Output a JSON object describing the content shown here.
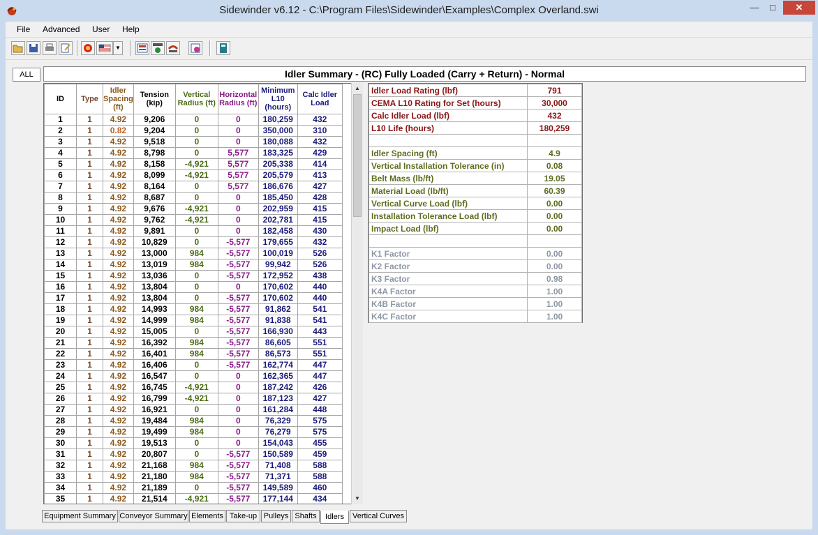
{
  "window": {
    "title": "Sidewinder v6.12 - C:\\Program Files\\Sidewinder\\Examples\\Complex Overland.swi"
  },
  "menu": [
    "File",
    "Advanced",
    "User",
    "Help"
  ],
  "filter_button": "ALL",
  "view_title": "Idler Summary - (RC) Fully Loaded (Carry + Return) - Normal",
  "table": {
    "headers": {
      "id": "ID",
      "type": "Type",
      "spacing": "Idler Spacing (ft)",
      "tension": "Tension (kip)",
      "vert": "Vertical Radius (ft)",
      "horiz": "Horizontal Radius (ft)",
      "l10": "Minimum L10 (hours)",
      "load": "Calc Idler Load"
    },
    "rows": [
      [
        "1",
        "1",
        "4.92",
        "9,206",
        "0",
        "0",
        "180,259",
        "432"
      ],
      [
        "2",
        "1",
        "0.82",
        "9,204",
        "0",
        "0",
        "350,000",
        "310"
      ],
      [
        "3",
        "1",
        "4.92",
        "9,518",
        "0",
        "0",
        "180,088",
        "432"
      ],
      [
        "4",
        "1",
        "4.92",
        "8,798",
        "0",
        "5,577",
        "183,325",
        "429"
      ],
      [
        "5",
        "1",
        "4.92",
        "8,158",
        "-4,921",
        "5,577",
        "205,338",
        "414"
      ],
      [
        "6",
        "1",
        "4.92",
        "8,099",
        "-4,921",
        "5,577",
        "205,579",
        "413"
      ],
      [
        "7",
        "1",
        "4.92",
        "8,164",
        "0",
        "5,577",
        "186,676",
        "427"
      ],
      [
        "8",
        "1",
        "4.92",
        "8,687",
        "0",
        "0",
        "185,450",
        "428"
      ],
      [
        "9",
        "1",
        "4.92",
        "9,676",
        "-4,921",
        "0",
        "202,959",
        "415"
      ],
      [
        "10",
        "1",
        "4.92",
        "9,762",
        "-4,921",
        "0",
        "202,781",
        "415"
      ],
      [
        "11",
        "1",
        "4.92",
        "9,891",
        "0",
        "0",
        "182,458",
        "430"
      ],
      [
        "12",
        "1",
        "4.92",
        "10,829",
        "0",
        "-5,577",
        "179,655",
        "432"
      ],
      [
        "13",
        "1",
        "4.92",
        "13,000",
        "984",
        "-5,577",
        "100,019",
        "526"
      ],
      [
        "14",
        "1",
        "4.92",
        "13,019",
        "984",
        "-5,577",
        "99,942",
        "526"
      ],
      [
        "15",
        "1",
        "4.92",
        "13,036",
        "0",
        "-5,577",
        "172,952",
        "438"
      ],
      [
        "16",
        "1",
        "4.92",
        "13,804",
        "0",
        "0",
        "170,602",
        "440"
      ],
      [
        "17",
        "1",
        "4.92",
        "13,804",
        "0",
        "-5,577",
        "170,602",
        "440"
      ],
      [
        "18",
        "1",
        "4.92",
        "14,993",
        "984",
        "-5,577",
        "91,862",
        "541"
      ],
      [
        "19",
        "1",
        "4.92",
        "14,999",
        "984",
        "-5,577",
        "91,838",
        "541"
      ],
      [
        "20",
        "1",
        "4.92",
        "15,005",
        "0",
        "-5,577",
        "166,930",
        "443"
      ],
      [
        "21",
        "1",
        "4.92",
        "16,392",
        "984",
        "-5,577",
        "86,605",
        "551"
      ],
      [
        "22",
        "1",
        "4.92",
        "16,401",
        "984",
        "-5,577",
        "86,573",
        "551"
      ],
      [
        "23",
        "1",
        "4.92",
        "16,406",
        "0",
        "-5,577",
        "162,774",
        "447"
      ],
      [
        "24",
        "1",
        "4.92",
        "16,547",
        "0",
        "0",
        "162,365",
        "447"
      ],
      [
        "25",
        "1",
        "4.92",
        "16,745",
        "-4,921",
        "0",
        "187,242",
        "426"
      ],
      [
        "26",
        "1",
        "4.92",
        "16,799",
        "-4,921",
        "0",
        "187,123",
        "427"
      ],
      [
        "27",
        "1",
        "4.92",
        "16,921",
        "0",
        "0",
        "161,284",
        "448"
      ],
      [
        "28",
        "1",
        "4.92",
        "19,484",
        "984",
        "0",
        "76,329",
        "575"
      ],
      [
        "29",
        "1",
        "4.92",
        "19,499",
        "984",
        "0",
        "76,279",
        "575"
      ],
      [
        "30",
        "1",
        "4.92",
        "19,513",
        "0",
        "0",
        "154,043",
        "455"
      ],
      [
        "31",
        "1",
        "4.92",
        "20,807",
        "0",
        "-5,577",
        "150,589",
        "459"
      ],
      [
        "32",
        "1",
        "4.92",
        "21,168",
        "984",
        "-5,577",
        "71,408",
        "588"
      ],
      [
        "33",
        "1",
        "4.92",
        "21,180",
        "984",
        "-5,577",
        "71,371",
        "588"
      ],
      [
        "34",
        "1",
        "4.92",
        "21,189",
        "0",
        "-5,577",
        "149,589",
        "460"
      ],
      [
        "35",
        "1",
        "4.92",
        "21,514",
        "-4,921",
        "-5,577",
        "177,144",
        "434"
      ]
    ]
  },
  "summary": [
    {
      "label": "Idler Load Rating (lbf)",
      "value": "791",
      "tone": "red"
    },
    {
      "label": "CEMA L10 Rating for Set (hours)",
      "value": "30,000",
      "tone": "red"
    },
    {
      "label": "Calc Idler Load (lbf)",
      "value": "432",
      "tone": "red"
    },
    {
      "label": "L10 Life (hours)",
      "value": "180,259",
      "tone": "red"
    },
    {
      "label": "",
      "value": "",
      "tone": "blank"
    },
    {
      "label": "Idler Spacing (ft)",
      "value": "4.9",
      "tone": "green"
    },
    {
      "label": "Vertical Installation Tolerance (in)",
      "value": "0.08",
      "tone": "green"
    },
    {
      "label": "Belt Mass (lb/ft)",
      "value": "19.05",
      "tone": "green"
    },
    {
      "label": "Material Load (lb/ft)",
      "value": "60.39",
      "tone": "green"
    },
    {
      "label": "Vertical Curve Load (lbf)",
      "value": "0.00",
      "tone": "green"
    },
    {
      "label": "Installation Tolerance Load (lbf)",
      "value": "0.00",
      "tone": "green"
    },
    {
      "label": "Impact Load (lbf)",
      "value": "0.00",
      "tone": "green"
    },
    {
      "label": "",
      "value": "",
      "tone": "blank"
    },
    {
      "label": "K1 Factor",
      "value": "0.00",
      "tone": "gray"
    },
    {
      "label": "K2 Factor",
      "value": "0.00",
      "tone": "gray"
    },
    {
      "label": "K3 Factor",
      "value": "0.98",
      "tone": "gray"
    },
    {
      "label": "K4A Factor",
      "value": "1.00",
      "tone": "gray"
    },
    {
      "label": "K4B Factor",
      "value": "1.00",
      "tone": "gray"
    },
    {
      "label": "K4C Factor",
      "value": "1.00",
      "tone": "gray"
    }
  ],
  "tabs": [
    {
      "label": "Equipment Summary",
      "active": false
    },
    {
      "label": "Conveyor Summary",
      "active": false
    },
    {
      "label": "Elements",
      "active": false
    },
    {
      "label": "Take-up",
      "active": false
    },
    {
      "label": "Pulleys",
      "active": false
    },
    {
      "label": "Shafts",
      "active": false
    },
    {
      "label": "Idlers",
      "active": true
    },
    {
      "label": "Vertical Curves",
      "active": false
    }
  ],
  "toolbar_icons": [
    "open-folder-icon",
    "save-icon",
    "print-icon",
    "edit-icon",
    "gauge-icon",
    "flag-icon",
    "dropdown-arrow-icon",
    "info-icon",
    "geometry-icon",
    "main-icon",
    "chart-icon",
    "calculator-icon"
  ]
}
